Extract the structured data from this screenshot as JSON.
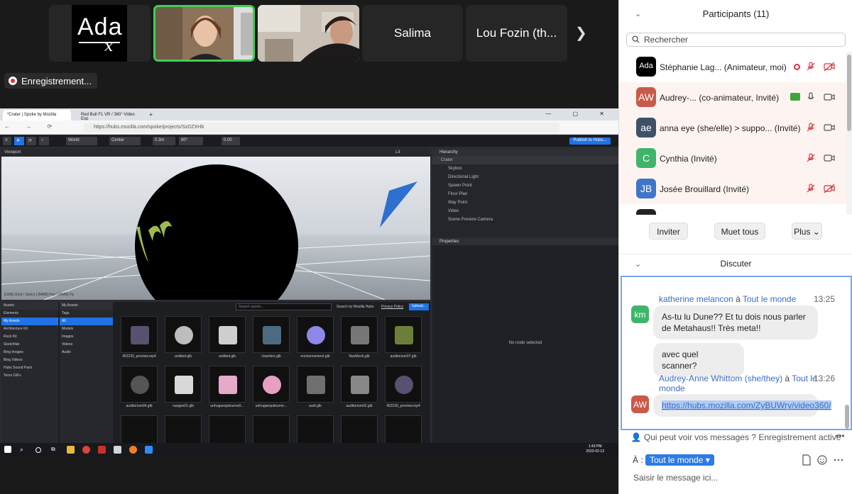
{
  "meeting": {
    "tiles": [
      {
        "kind": "logo",
        "logo_text": "Ada",
        "logo_sub": "x"
      },
      {
        "kind": "video"
      },
      {
        "kind": "video"
      },
      {
        "kind": "name",
        "name": "Salima"
      },
      {
        "kind": "name",
        "name": "Lou Fozin (th..."
      }
    ],
    "recording_label": "Enregistrement..."
  },
  "shared_screen": {
    "browser_tabs": [
      "*Crater | Spoke by Mozilla",
      "Red Bull F1 VR / 360° Video Exp"
    ],
    "url": "https://hubs.mozilla.com/spoke/projects/SzDZXHb",
    "toolbar": {
      "world": "World",
      "center": "Center",
      "snap": "0.3m",
      "angle": "90°",
      "scale": "0.00",
      "publish": "Publish to Hubs..."
    },
    "viewport": {
      "title": "Viewport",
      "lit": "Lit",
      "hint": "[LMB] Orbit / Select | [MMB] Pan | [RMB] Fly"
    },
    "hierarchy": {
      "title": "Hierarchy",
      "items": [
        "Crater",
        "Skybox",
        "Directional Light",
        "Spawn Point",
        "Floor Plan",
        "Way Point",
        "Video",
        "Scene Preview Camera"
      ]
    },
    "properties": {
      "title": "Properties",
      "empty": "No node selected"
    },
    "assets": {
      "title": "Assets",
      "my_assets": "My Assets",
      "tags_label": "Tags",
      "search_placeholder": "Search assets...",
      "search_by": "Search by Mozilla Hubs",
      "privacy": "Privacy Policy",
      "upload": "Upload...",
      "sources": [
        "Elements",
        "My Assets",
        "Architecture Kit",
        "Rock Kit",
        "Sketchfab",
        "Bing Images",
        "Bing Videos",
        "Hubs Sound Pack",
        "Tenor GIFs"
      ],
      "tags": [
        "All",
        "Models",
        "Images",
        "Videos",
        "Audio"
      ],
      "items": [
        "452230_preview.mp4",
        "untitled.glb",
        "untitled.glb",
        "chambre.glb",
        "environnement.glb",
        "NavMesh.glb",
        "auditorium07.glb",
        "auditorium04.glb",
        "nuages01.glb",
        "unhugaequitourne0...",
        "unhugaequitourne...",
        "audi.glb",
        "auditorium02.glb",
        "452230_preview.mp4"
      ]
    },
    "taskbar": {
      "time": "1:43 PM",
      "date": "2022-02-13"
    }
  },
  "participants": {
    "title": "Participants (11)",
    "search_placeholder": "Rechercher",
    "rows": [
      {
        "initials": "Ada",
        "color": "#000000",
        "name": "Stéphanie Lag... (Animateur, moi)"
      },
      {
        "initials": "AW",
        "color": "#c85a4a",
        "name": "Audrey-...  (co-animateur, Invité)"
      },
      {
        "initials": "ae",
        "color": "#3f5167",
        "name": "anna eye (she/elle) > suppo... (Invité)"
      },
      {
        "initials": "C",
        "color": "#3fb56b",
        "name": "Cynthia (Invité)"
      },
      {
        "initials": "JB",
        "color": "#3f76c8",
        "name": "Josée Brouillard (Invité)"
      }
    ],
    "buttons": {
      "invite": "Inviter",
      "mute_all": "Muet tous",
      "more": "Plus"
    }
  },
  "chat": {
    "title": "Discuter",
    "messages": [
      {
        "from": "katherine melancon",
        "to_sep": "à",
        "to": "Tout le monde",
        "time": "13:25",
        "initials": "km",
        "color": "#3fb56b",
        "lines": [
          "As-tu lu Dune?? Et tu dois nous parler de Metahaus!! Très meta!!",
          "avec quel scanner?"
        ]
      },
      {
        "from": "Audrey-Anne Whittom (she/they)",
        "to_sep": "à",
        "to": "Tout le monde",
        "time": "13:26",
        "initials": "AW",
        "color": "#c85a4a",
        "lines": [
          "https://hubs.mozilla.com/ZyBUWry/video360/"
        ]
      }
    ],
    "notice": "Qui peut voir vos messages ? Enregistrement activé",
    "to_label": "À :",
    "to_value": "Tout le monde",
    "input_placeholder": "Saisir le message ici..."
  }
}
